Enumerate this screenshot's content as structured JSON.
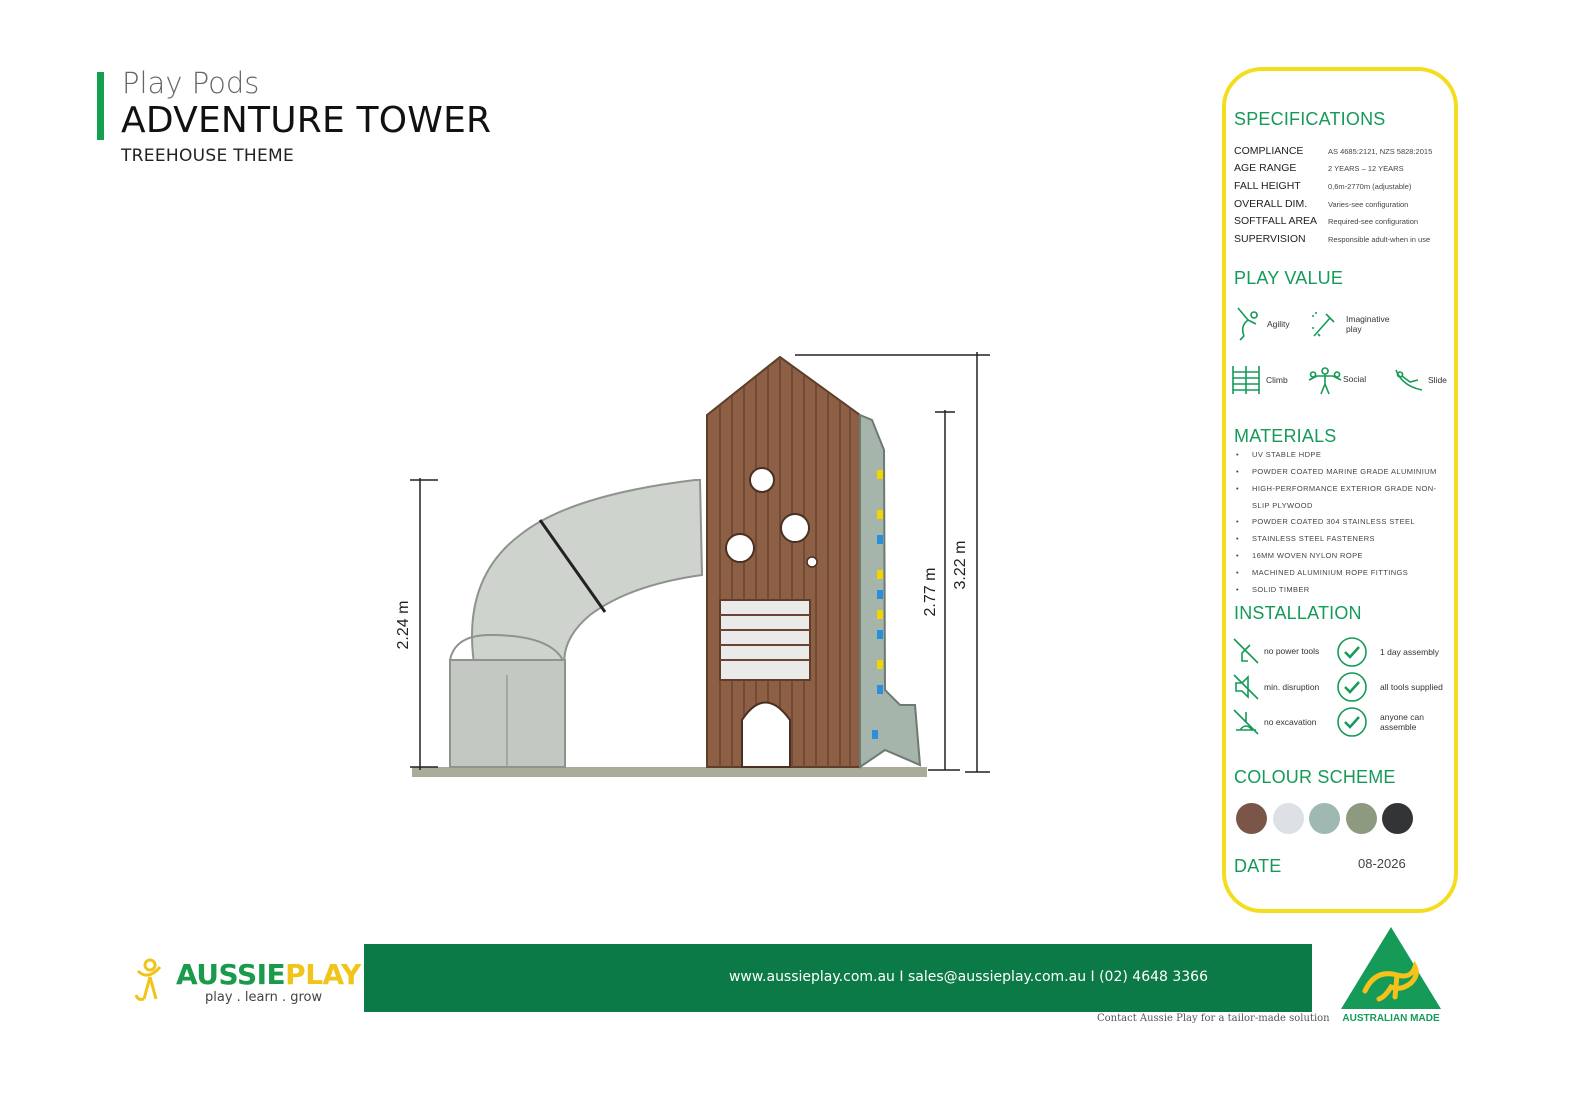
{
  "header": {
    "category": "Play Pods",
    "product": "ADVENTURE TOWER",
    "theme": "TREEHOUSE THEME"
  },
  "drawing": {
    "dim_left": "2.24 m",
    "dim_mid": "2.77 m",
    "dim_right": "3.22 m"
  },
  "specifications": {
    "heading": "SPECIFICATIONS",
    "rows": [
      {
        "key": "COMPLIANCE",
        "value": "AS 4685:2121, NZS 5828:2015"
      },
      {
        "key": "AGE RANGE",
        "value": "2 YEARS – 12 YEARS"
      },
      {
        "key": "FALL HEIGHT",
        "value": "0,6m-2770m (adjustable)"
      },
      {
        "key": "OVERALL DIM.",
        "value": "Varies-see configuration"
      },
      {
        "key": "SOFTFALL AREA",
        "value": "Required-see configuration"
      },
      {
        "key": "SUPERVISION",
        "value": "Responsible adult-when in use"
      }
    ]
  },
  "play_value": {
    "heading": "PLAY VALUE",
    "items": [
      {
        "label": "Agility",
        "icon": "agility-icon"
      },
      {
        "label": "Imaginative play",
        "icon": "imaginative-play-icon"
      },
      {
        "label": "Climb",
        "icon": "climb-icon"
      },
      {
        "label": "Social",
        "icon": "social-icon"
      },
      {
        "label": "Slide",
        "icon": "slide-icon"
      }
    ]
  },
  "materials": {
    "heading": "MATERIALS",
    "items": [
      "UV STABLE HDPE",
      "POWDER COATED MARINE GRADE ALUMINIUM",
      "HIGH-PERFORMANCE EXTERIOR GRADE  NON-SLIP PLYWOOD",
      "POWDER COATED 304 STAINLESS STEEL",
      "STAINLESS STEEL FASTENERS",
      "16MM WOVEN NYLON ROPE",
      "MACHINED ALUMINIUM ROPE FITTINGS",
      "SOLID TIMBER"
    ]
  },
  "installation": {
    "heading": "INSTALLATION",
    "items": [
      {
        "label": "no power tools",
        "icon": "no-power-tools-icon"
      },
      {
        "label": "1 day assembly",
        "icon": "check-icon"
      },
      {
        "label": "min. disruption",
        "icon": "min-disruption-icon"
      },
      {
        "label": "all tools supplied",
        "icon": "check-icon"
      },
      {
        "label": "no excavation",
        "icon": "no-excavation-icon"
      },
      {
        "label": "anyone can assemble",
        "icon": "check-icon"
      }
    ]
  },
  "colour_scheme": {
    "heading": "COLOUR SCHEME",
    "swatches": [
      "#7b5547",
      "#dde1e6",
      "#9fb9b2",
      "#8e9a7f",
      "#333436"
    ]
  },
  "date": {
    "heading": "DATE",
    "value": "08-2026"
  },
  "footer": {
    "brand_aussie": "AUSSIE",
    "brand_play": "PLAY",
    "tagline": "play . learn . grow",
    "contact": "www.aussieplay.com.au   I   sales@aussieplay.com.au   I   (02) 4648 3366",
    "tailor": "Contact Aussie Play for a tailor-made solution",
    "australian_made": "AUSTRALIAN MADE"
  },
  "colors": {
    "accent_green": "#159a58",
    "card_border": "#f4dd1e",
    "contact_bar": "#0b7a47"
  }
}
